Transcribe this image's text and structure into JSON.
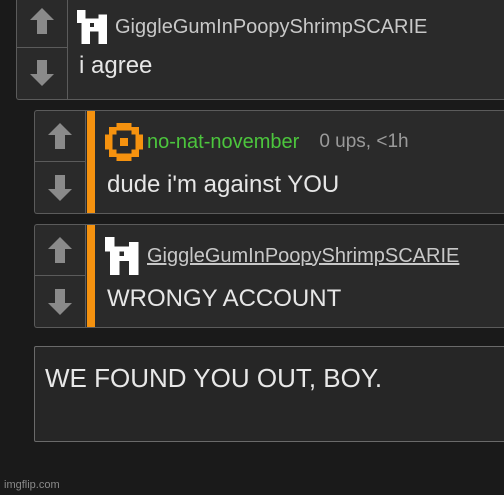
{
  "comments": [
    {
      "username": "GiggleGumInPoopyShrimpSCARIE",
      "text": "i agree",
      "meta": ""
    },
    {
      "username": "no-nat-november",
      "text": "dude i'm against YOU",
      "meta": "0 ups, <1h"
    },
    {
      "username": "GiggleGumInPoopyShrimpSCARIE",
      "text": "WRONGY ACCOUNT",
      "meta": ""
    }
  ],
  "reply_box": {
    "value": "WE FOUND YOU OUT, BOY."
  },
  "watermark": "imgflip.com",
  "colors": {
    "accent": "#f5920f",
    "username_green": "#4cc53d",
    "background": "#1a1a1a",
    "panel": "#2a2a2a"
  },
  "icons": {
    "upvote": "arrow-up-icon",
    "downvote": "arrow-down-icon",
    "avatar_user1": "pixel-dog-avatar-icon",
    "avatar_user2": "orange-pixel-ring-avatar-icon"
  }
}
